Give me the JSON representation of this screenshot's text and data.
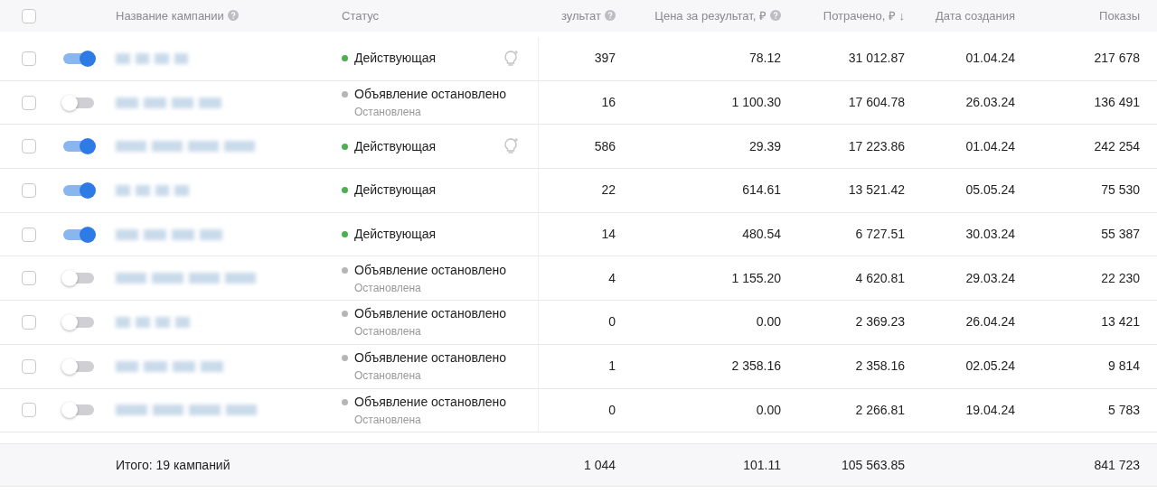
{
  "select_all": {
    "checked": false
  },
  "columns": [
    {
      "label": "Название кампании",
      "help": true
    },
    {
      "label": "Статус",
      "help": false
    },
    {
      "label": "зультат",
      "help": true
    },
    {
      "label": "Цена за результат, ₽",
      "help": true
    },
    {
      "label": "Потрачено, ₽ ↓",
      "help": false
    },
    {
      "label": "Дата создания",
      "help": false
    },
    {
      "label": "Показы",
      "help": false
    }
  ],
  "rows": [
    {
      "checked": false,
      "on": true,
      "status": "Действующая",
      "substatus": null,
      "hint": true,
      "results": "397",
      "cost": "78.12",
      "spent": "31 012.87",
      "date": "01.04.24",
      "impressions": "217 678"
    },
    {
      "checked": false,
      "on": false,
      "status": "Объявление остановлено",
      "substatus": "Остановлена",
      "hint": false,
      "results": "16",
      "cost": "1 100.30",
      "spent": "17 604.78",
      "date": "26.03.24",
      "impressions": "136 491"
    },
    {
      "checked": false,
      "on": true,
      "status": "Действующая",
      "substatus": null,
      "hint": true,
      "results": "586",
      "cost": "29.39",
      "spent": "17 223.86",
      "date": "01.04.24",
      "impressions": "242 254"
    },
    {
      "checked": false,
      "on": true,
      "status": "Действующая",
      "substatus": null,
      "hint": false,
      "results": "22",
      "cost": "614.61",
      "spent": "13 521.42",
      "date": "05.05.24",
      "impressions": "75 530"
    },
    {
      "checked": false,
      "on": true,
      "status": "Действующая",
      "substatus": null,
      "hint": false,
      "results": "14",
      "cost": "480.54",
      "spent": "6 727.51",
      "date": "30.03.24",
      "impressions": "55 387"
    },
    {
      "checked": false,
      "on": false,
      "status": "Объявление остановлено",
      "substatus": "Остановлена",
      "hint": false,
      "results": "4",
      "cost": "1 155.20",
      "spent": "4 620.81",
      "date": "29.03.24",
      "impressions": "22 230"
    },
    {
      "checked": false,
      "on": false,
      "status": "Объявление остановлено",
      "substatus": "Остановлена",
      "hint": false,
      "results": "0",
      "cost": "0.00",
      "spent": "2 369.23",
      "date": "26.04.24",
      "impressions": "13 421"
    },
    {
      "checked": false,
      "on": false,
      "status": "Объявление остановлено",
      "substatus": "Остановлена",
      "hint": false,
      "results": "1",
      "cost": "2 358.16",
      "spent": "2 358.16",
      "date": "02.05.24",
      "impressions": "9 814"
    },
    {
      "checked": false,
      "on": false,
      "status": "Объявление остановлено",
      "substatus": "Остановлена",
      "hint": false,
      "results": "0",
      "cost": "0.00",
      "spent": "2 266.81",
      "date": "19.04.24",
      "impressions": "5 783"
    }
  ],
  "footer": {
    "label": "Итого: 19 кампаний",
    "results": "1 044",
    "cost": "101.11",
    "spent": "105 563.85",
    "impressions": "841 723"
  }
}
